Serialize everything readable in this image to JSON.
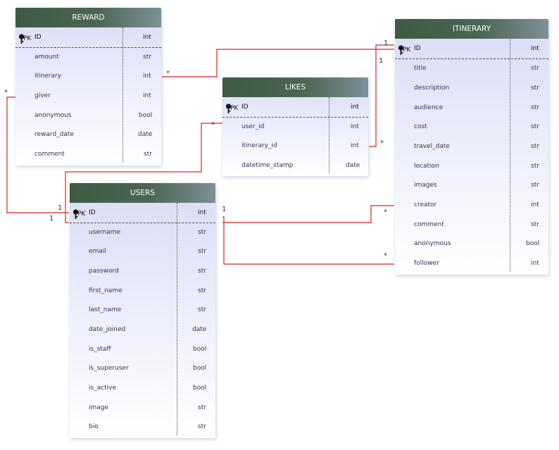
{
  "entities": {
    "reward": {
      "title": "REWARD",
      "pk_marker": "PK",
      "fields": [
        {
          "name": "ID",
          "type": "int"
        },
        {
          "name": "amount",
          "type": "str"
        },
        {
          "name": "itinerary",
          "type": "int"
        },
        {
          "name": "giver",
          "type": "int"
        },
        {
          "name": "anonymous",
          "type": "bool"
        },
        {
          "name": "reward_date",
          "type": "date"
        },
        {
          "name": "comment",
          "type": "str"
        }
      ]
    },
    "likes": {
      "title": "LIKES",
      "pk_marker": "PK",
      "fields": [
        {
          "name": "ID",
          "type": "int"
        },
        {
          "name": "user_id",
          "type": "int"
        },
        {
          "name": "itinerary_id",
          "type": "int"
        },
        {
          "name": "datetime_stamp",
          "type": "date"
        }
      ]
    },
    "itinerary": {
      "title": "ITINERARY",
      "pk_marker": "PK",
      "fields": [
        {
          "name": "ID",
          "type": "int"
        },
        {
          "name": "title",
          "type": "str"
        },
        {
          "name": "description",
          "type": "str"
        },
        {
          "name": "audience",
          "type": "str"
        },
        {
          "name": "cost",
          "type": "str"
        },
        {
          "name": "travel_date",
          "type": "str"
        },
        {
          "name": "location",
          "type": "str"
        },
        {
          "name": "images",
          "type": "str"
        },
        {
          "name": "creator",
          "type": "int"
        },
        {
          "name": "comment",
          "type": "str"
        },
        {
          "name": "anonymous",
          "type": "bool"
        },
        {
          "name": "follower",
          "type": "int"
        }
      ]
    },
    "users": {
      "title": "USERS",
      "pk_marker": "PK",
      "fields": [
        {
          "name": "ID",
          "type": "int"
        },
        {
          "name": "username",
          "type": "str"
        },
        {
          "name": "email",
          "type": "str"
        },
        {
          "name": "password",
          "type": "str"
        },
        {
          "name": "first_name",
          "type": "str"
        },
        {
          "name": "last_name",
          "type": "str"
        },
        {
          "name": "date_joined",
          "type": "date"
        },
        {
          "name": "is_staff",
          "type": "bool"
        },
        {
          "name": "is_superuser",
          "type": "bool"
        },
        {
          "name": "is_active",
          "type": "bool"
        },
        {
          "name": "image",
          "type": "str"
        },
        {
          "name": "bio",
          "type": "str"
        }
      ]
    }
  },
  "relationships": [
    {
      "name": "reward-itinerary-to-itinerary-id",
      "from_label": "*",
      "to_label": "1"
    },
    {
      "name": "likes-itinerary-id-to-itinerary-id",
      "from_label": "*",
      "to_label": "1"
    },
    {
      "name": "reward-giver-to-users-id",
      "from_label": "*",
      "to_label": "1"
    },
    {
      "name": "likes-user-id-to-users-id",
      "from_label": "*",
      "to_label": "1"
    },
    {
      "name": "itinerary-creator-to-users-id",
      "from_label": "*",
      "to_label": "1"
    },
    {
      "name": "itinerary-follower-to-users-id",
      "from_label": "*",
      "to_label": ""
    }
  ],
  "colors": {
    "relation_line": "#e02020",
    "header_dark": "#3d5a42",
    "header_light": "#7d9097",
    "body_tint": "#d8dcf6"
  },
  "icons": {
    "primary_key": "key-icon"
  }
}
